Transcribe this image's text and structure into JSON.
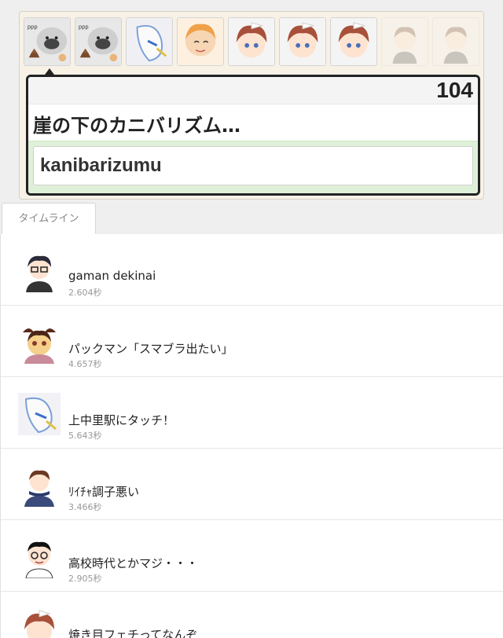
{
  "game": {
    "score": "104",
    "current_word": "崖の下のカニバリズム…",
    "input_value": "kanibarizumu"
  },
  "players": [
    {
      "icon": "dog-with-poop-icon"
    },
    {
      "icon": "dog-with-poop-icon"
    },
    {
      "icon": "blue-sketch-character-icon"
    },
    {
      "icon": "orange-hair-character-icon"
    },
    {
      "icon": "brown-hair-girl-icon"
    },
    {
      "icon": "brown-hair-girl-icon"
    },
    {
      "icon": "brown-hair-girl-icon"
    },
    {
      "icon": "boy-character-icon"
    },
    {
      "icon": "boy-character-icon"
    }
  ],
  "tabs": [
    {
      "label": "タイムライン"
    }
  ],
  "timeline": [
    {
      "text": "gaman dekinai",
      "time": "2.604秒",
      "icon": "glasses-boy-icon"
    },
    {
      "text": "パックマン「スマブラ出たい」",
      "time": "4.657秒",
      "icon": "ribbon-girl-icon"
    },
    {
      "text": "上中里駅にタッチ！",
      "time": "5.643秒",
      "icon": "blue-sketch-character-icon"
    },
    {
      "text": "ﾘｲﾁｬ調子悪い",
      "time": "3.466秒",
      "icon": "scarf-boy-icon"
    },
    {
      "text": "高校時代とかマジ・・・",
      "time": "2.905秒",
      "icon": "glasses-man-icon"
    },
    {
      "text": "焼き目フェチってなんぞ",
      "time": "",
      "icon": "brown-hair-girl-icon"
    }
  ],
  "colors": {
    "panel_bg": "#f7f1e6",
    "input_area_bg": "#dff0d8",
    "card_border": "#222222"
  }
}
